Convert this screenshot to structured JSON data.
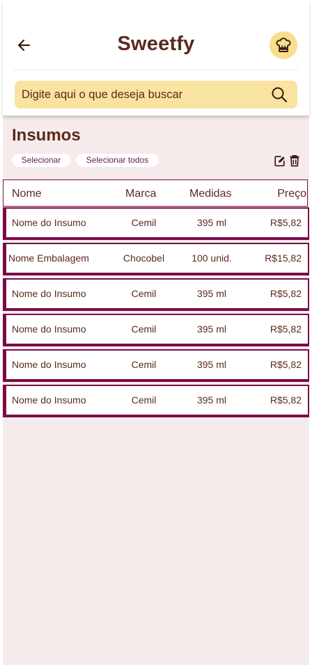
{
  "app": {
    "title": "Sweetfy"
  },
  "search": {
    "placeholder": "Digite aqui o que deseja buscar"
  },
  "section": {
    "title": "Insumos"
  },
  "actions": {
    "select_label": "Selecionar",
    "select_all_label": "Selecionar todos"
  },
  "icons": {
    "back": "arrow-left-icon",
    "avatar": "chef-hat-icon",
    "search": "search-icon",
    "edit": "edit-icon",
    "delete": "trash-icon"
  },
  "colors": {
    "brand": "#5b2a1d",
    "accent": "#7a0b4a",
    "search_bg": "#f9e3a0",
    "avatar_bg": "#f7df8d",
    "page_bg": "#f5ebea"
  },
  "table": {
    "headers": {
      "nome": "Nome",
      "marca": "Marca",
      "medidas": "Medidas",
      "preco": "Preço"
    },
    "rows": [
      {
        "nome": "Nome do Insumo",
        "marca": "Cemil",
        "medidas": "395 ml",
        "preco": "R$5,82"
      },
      {
        "nome": "Nome Embalagem",
        "marca": "Chocobel",
        "medidas": "100 unid.",
        "preco": "R$15,82"
      },
      {
        "nome": "Nome do Insumo",
        "marca": "Cemil",
        "medidas": "395 ml",
        "preco": "R$5,82"
      },
      {
        "nome": "Nome do Insumo",
        "marca": "Cemil",
        "medidas": "395 ml",
        "preco": "R$5,82"
      },
      {
        "nome": "Nome do Insumo",
        "marca": "Cemil",
        "medidas": "395 ml",
        "preco": "R$5,82"
      },
      {
        "nome": "Nome do Insumo",
        "marca": "Cemil",
        "medidas": "395 ml",
        "preco": "R$5,82"
      }
    ]
  }
}
